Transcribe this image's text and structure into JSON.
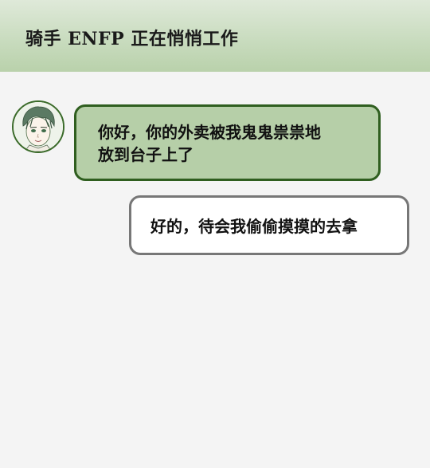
{
  "header": {
    "title": "骑手  ENFP  正在悄悄工作"
  },
  "messages": [
    {
      "sender": "骑手",
      "direction": "incoming",
      "lines": [
        "你好，你的外卖被我鬼鬼祟祟地",
        "放到台子上了"
      ]
    },
    {
      "sender": "me",
      "direction": "outgoing",
      "lines": [
        "好的，待会我偷偷摸摸的去拿"
      ]
    }
  ],
  "colors": {
    "header_bg": "#c9dcbf",
    "incoming_bubble_bg": "#b6cfa8",
    "incoming_bubble_border": "#2f5e1f",
    "outgoing_bubble_bg": "#ffffff",
    "outgoing_bubble_border": "#777777",
    "page_bg": "#f4f4f4"
  }
}
